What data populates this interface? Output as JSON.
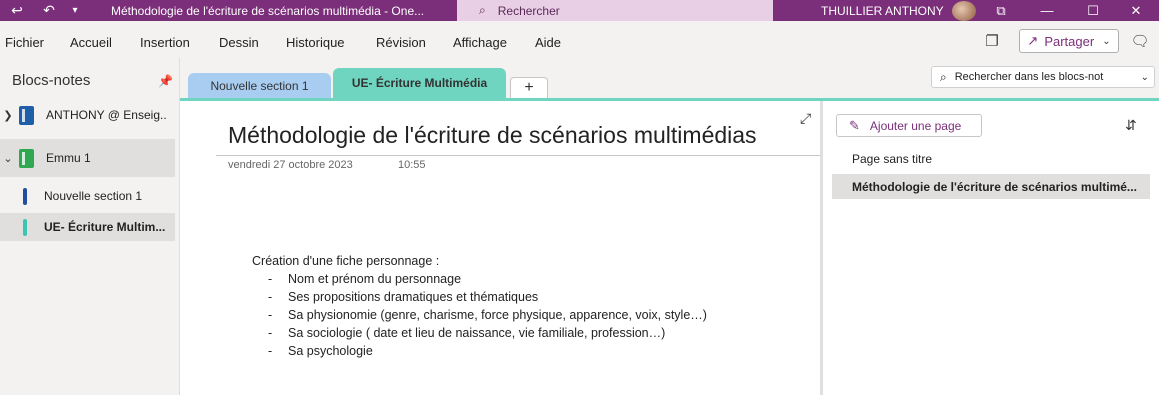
{
  "titlebar": {
    "title": "Méthodologie de l'écriture de scénarios multimédia  -  One...",
    "search_label": "Rechercher",
    "user_name": "THUILLIER ANTHONY"
  },
  "menu": {
    "items": [
      "Fichier",
      "Accueil",
      "Insertion",
      "Dessin",
      "Historique",
      "Révision",
      "Affichage",
      "Aide"
    ],
    "share_label": "Partager"
  },
  "sidebar": {
    "title": "Blocs-notes",
    "notebooks": [
      {
        "label": "ANTHONY @ Enseig...",
        "color": "#1f5fa8"
      },
      {
        "label": "Emmu 1",
        "color": "#2fa84f"
      }
    ],
    "sections": [
      {
        "label": "Nouvelle section 1",
        "color": "#1f4f9e"
      },
      {
        "label": "UE- Écriture Multim...",
        "color": "#3ac6b0"
      }
    ]
  },
  "tabs": [
    {
      "label": "Nouvelle section 1",
      "color": "#a9cdf0"
    },
    {
      "label": "UE- Écriture Multimédia",
      "color": "#6fd5c0"
    }
  ],
  "notebook_search": {
    "placeholder": "Rechercher dans les blocs-not"
  },
  "page": {
    "title": "Méthodologie de l'écriture de scénarios multimédias",
    "date": "vendredi 27 octobre 2023",
    "time": "10:55",
    "heading": "Création d'une fiche personnage :",
    "bullets": [
      "Nom et prénom du personnage",
      "Ses propositions dramatiques et thématiques",
      "Sa physionomie (genre, charisme, force physique, apparence, voix, style…)",
      "Sa sociologie ( date et lieu de naissance, vie familiale, profession…)",
      "Sa psychologie"
    ]
  },
  "pages_pane": {
    "add_label": "Ajouter une page",
    "pages": [
      {
        "label": "Page sans titre"
      },
      {
        "label": "Méthodologie de l'écriture de scénarios multimé..."
      }
    ]
  },
  "colors": {
    "accent": "#7b2e79",
    "section_accent": "#6fd5c0"
  }
}
